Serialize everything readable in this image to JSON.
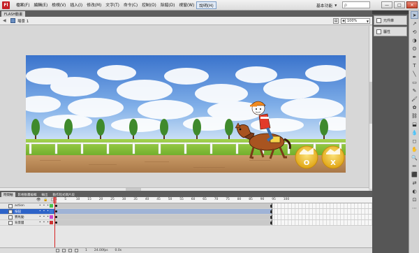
{
  "app": {
    "icon_letter": "Fl",
    "menus": [
      "檔案(F)",
      "編輯(E)",
      "檢視(V)",
      "插入(I)",
      "修改(M)",
      "文字(T)",
      "命令(C)",
      "控制(O)",
      "除錯(D)",
      "視窗(W)",
      "說明(H)"
    ],
    "active_menu": "說明(H)",
    "workspace_label": "基本功能",
    "search_placeholder": "ρ",
    "window_buttons": [
      "—",
      "□",
      "✕"
    ]
  },
  "document": {
    "tab_label": "FLASH動畫",
    "scene_label": "場景 1",
    "zoom": "100%"
  },
  "stage": {
    "sky_color": "#4f86d6",
    "grass_color": "#8cc43c",
    "dirt_color": "#bf8d59",
    "button_o": "O",
    "button_x": "X"
  },
  "panels": {
    "items": [
      {
        "label": "元件庫",
        "icon": "library-icon"
      },
      {
        "label": "屬性",
        "icon": "properties-icon"
      }
    ]
  },
  "tools": [
    {
      "glyph": "➤",
      "name": "selection-tool-icon"
    },
    {
      "glyph": "↗",
      "name": "subselect-tool-icon"
    },
    {
      "glyph": "⟲",
      "name": "free-transform-icon"
    },
    {
      "glyph": "◑",
      "name": "3d-rotation-icon"
    },
    {
      "glyph": "ʘ",
      "name": "lasso-icon"
    },
    {
      "glyph": "✒",
      "name": "pen-tool-icon"
    },
    {
      "glyph": "T",
      "name": "text-tool-icon"
    },
    {
      "glyph": "╲",
      "name": "line-tool-icon"
    },
    {
      "glyph": "▭",
      "name": "rectangle-tool-icon"
    },
    {
      "glyph": "✎",
      "name": "pencil-tool-icon"
    },
    {
      "glyph": "🖌",
      "name": "brush-tool-icon"
    },
    {
      "glyph": "✿",
      "name": "deco-tool-icon"
    },
    {
      "glyph": "⛓",
      "name": "bone-tool-icon"
    },
    {
      "glyph": "⬓",
      "name": "paint-bucket-icon"
    },
    {
      "glyph": "💧",
      "name": "eyedropper-icon"
    },
    {
      "glyph": "◻",
      "name": "eraser-icon"
    },
    {
      "glyph": "✋",
      "name": "hand-tool-icon"
    },
    {
      "glyph": "🔍",
      "name": "zoom-tool-icon"
    },
    {
      "glyph": "✏",
      "name": "stroke-color-icon"
    },
    {
      "glyph": "⬛",
      "name": "fill-color-icon"
    },
    {
      "glyph": "⇄",
      "name": "swap-colors-icon"
    },
    {
      "glyph": "◐",
      "name": "black-white-icon"
    },
    {
      "glyph": "⊡",
      "name": "snap-icon"
    },
    {
      "glyph": "⋯",
      "name": "options-icon"
    }
  ],
  "bottom_tabs": [
    "時間軸",
    "影格動畫編輯",
    "輸出",
    "動作程式碼片段"
  ],
  "timeline": {
    "ticks": [
      "1",
      "5",
      "10",
      "15",
      "20",
      "25",
      "30",
      "35",
      "40",
      "45",
      "50",
      "55",
      "60",
      "65",
      "70",
      "75",
      "80",
      "85",
      "90",
      "95",
      "100"
    ],
    "layers": [
      {
        "name": "action",
        "color": "#4ac04a"
      },
      {
        "name": "按鈕",
        "color": "#3a78d6"
      },
      {
        "name": "賽馬動",
        "color": "#cc44cc"
      },
      {
        "name": "背景層",
        "color": "#cc3333"
      }
    ],
    "selected_layer": "按鈕",
    "footer_stats": [
      "1",
      "24.00fps",
      "0.0s"
    ]
  }
}
